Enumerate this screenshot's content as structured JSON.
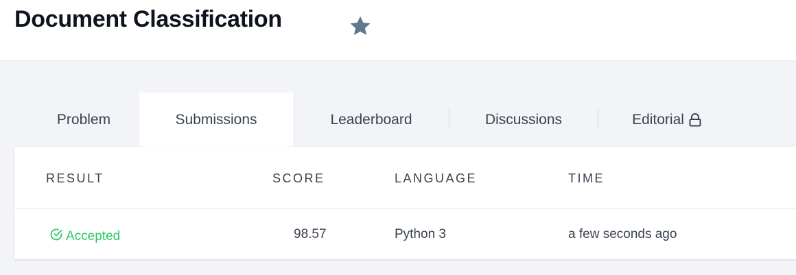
{
  "page": {
    "title": "Document Classification",
    "favorite_icon": "star-icon"
  },
  "tabs": [
    {
      "label": "Problem",
      "active": false
    },
    {
      "label": "Submissions",
      "active": true
    },
    {
      "label": "Leaderboard",
      "active": false
    },
    {
      "label": "Discussions",
      "active": false
    },
    {
      "label": "Editorial",
      "active": false,
      "icon": "lock-icon"
    }
  ],
  "table": {
    "headers": [
      "RESULT",
      "SCORE",
      "LANGUAGE",
      "TIME"
    ],
    "rows": [
      {
        "result": "Accepted",
        "result_icon": "check-circle-icon",
        "score": "98.57",
        "language": "Python 3",
        "time": "a few seconds ago"
      }
    ]
  },
  "colors": {
    "accepted": "#2ec866",
    "star": "#5c7a8a",
    "title": "#0e141e"
  }
}
